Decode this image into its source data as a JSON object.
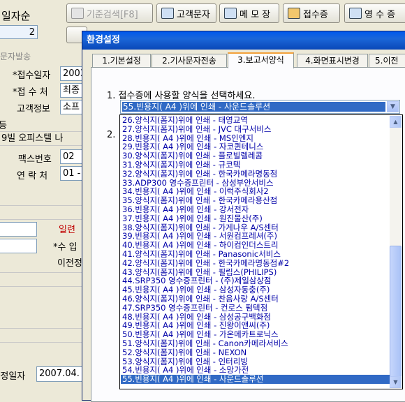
{
  "toolbar": {
    "buttons": [
      {
        "label": "기준검색[F8]"
      },
      {
        "label": "고객문자"
      },
      {
        "label": "메 모 장"
      },
      {
        "label": "접수증"
      },
      {
        "label": "영 수 증"
      }
    ]
  },
  "left_panel": {
    "top_label": "일자순",
    "top_value": "2",
    "sms_label": "문자발송",
    "receipt_date_label": "*접수일자",
    "receipt_date_value": "2003",
    "receipt_place_label": "*접 수 처",
    "receipt_place_value": "최종",
    "customer_info_label": "고객정보",
    "customer_info_value": "소프",
    "region_fragment": "등",
    "address_fragment": "9빌 오피스텔 나",
    "fax_label": "팩스번호",
    "fax_value": "02",
    "contact_label": "연 락 처",
    "contact_value": "01 -",
    "serial_fragment": "일련",
    "receive_fragment": "*수 입",
    "transfer_fragment": "이전정",
    "modify_date_label": "|정일자",
    "modify_date_value": "2007.04."
  },
  "dialog": {
    "title": "환경설정",
    "tabs": [
      {
        "label": "1.기본설정"
      },
      {
        "label": "2.기사문자전송"
      },
      {
        "label": "3.보고서양식",
        "active": true
      },
      {
        "label": "4.화면표시변경"
      },
      {
        "label": "5.이전"
      }
    ],
    "question1": "1. 접수증에 사용할 양식을 선택하세요.",
    "question2_number": "2.",
    "combo_selected": "55.빈용지( A4 )위에 인쇄 - 사운드솔루션",
    "options": [
      "26.양식지(폼지)위에 인쇄 - 태영교역",
      "27.양식지(폼지)위에 인쇄 - JVC 대구서비스",
      "28.빈용지( A4 )위에 인쇄 - MS인엔지",
      "29.빈용지( A4 )위에 인쇄 - 자코퀸테니스",
      "30.양식지(폼지)위에 인쇄 - 플로빌렐레콤",
      "31.양식지(폼지)위에 인쇄 - 규코텍",
      "32.양식지(폼지)위에 인쇄 - 한국카메라명동점",
      "33.ADP300 영수증프린터 - 삼성부안서비스",
      "34.빈용지( A4 )위에 인쇄 - 이럭주식회사2",
      "35.양식지(폼지)위에 인쇄 - 한국카메라용산점",
      "36.빈용지( A4 )위에 인쇄 - 강서전자",
      "37.빈용지( A4 )위에 인쇄 - 원진물산(주)",
      "38.양식지(폼지)위에 인쇄 - 가게나우 A/S센터",
      "39.빈용지( A4 )위에 인쇄 - 서원컴프레셔(주)",
      "40.빈용지( A4 )위에 인쇄 - 하이컴인더스트리",
      "41.양식지(폼지)위에 인쇄 - Panasonic서비스",
      "42.양식지(폼지)위에 인쇄 - 한국카메라명동점#2",
      "43.양식지(폼지)위에 인쇄 - 필립스(PHILIPS)",
      "44.SRP350 영수증프린터 - (주)제일삼상점",
      "45.빈용지( A4 )위에 인쇄 - 삼성자동충(주)",
      "46.양식지(폼지)위에 인쇄 - 찬음사랑 A/S센터",
      "47.SRP350 영수증프린터 - 컨로스 펌텍점",
      "48.빈용지( A4 )위에 인쇄 - 삼성공구백화점",
      "49.빈용지( A4 )위에 인쇄 - 진왕이앤씨(주)",
      "50.빈용지( A4 )위에 인쇄 - 가온메카트로닉스",
      "51.양식지(폼지)위에 인쇄 - Canon카메라서비스",
      "52.양식지(폼지)위에 인쇄 - NEXON",
      "53.양식지(폼지)위에 인쇄 - 인터리빙",
      "54.빈용지( A4 )위에 인쇄 - 소망가전",
      "55.빈용지( A4 )위에 인쇄 - 사운드솔루션"
    ],
    "selected_index": 29
  },
  "colors": {
    "titlebar": "#0a52d6",
    "selection": "#316ac5",
    "option_text": "#0000a8",
    "alert_text": "#c00000"
  }
}
